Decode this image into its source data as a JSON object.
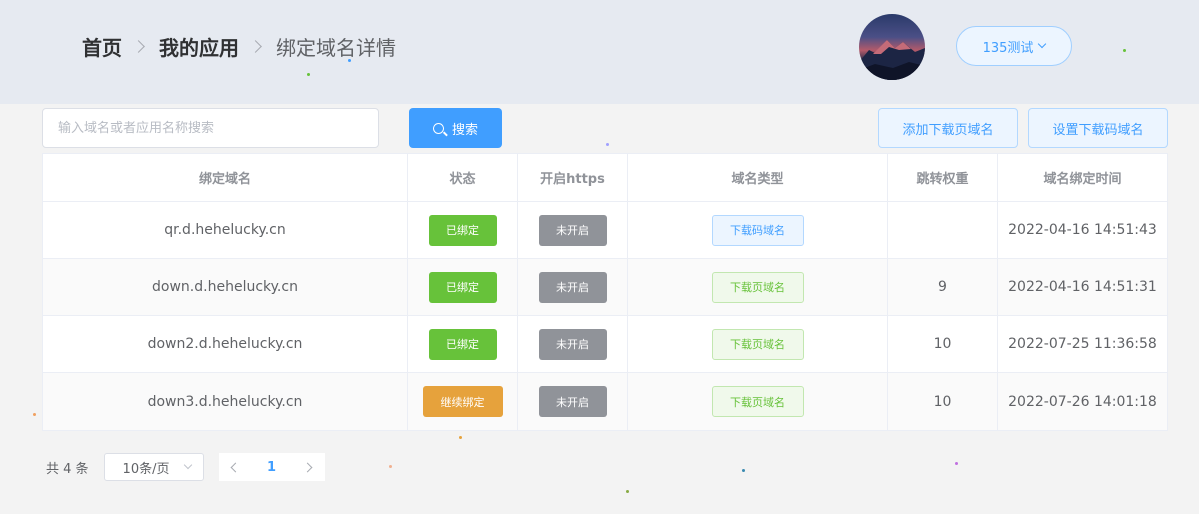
{
  "breadcrumb": {
    "home": "首页",
    "apps": "我的应用",
    "current": "绑定域名详情"
  },
  "user": {
    "name": "135测试",
    "avatar_icon": "avatar-mountain"
  },
  "toolbar": {
    "search_placeholder": "输入域名或者应用名称搜索",
    "search_value": "",
    "search_label": "搜索",
    "add_download_domain_label": "添加下载页域名",
    "set_qrcode_domain_label": "设置下载码域名"
  },
  "table": {
    "columns": [
      "绑定域名",
      "状态",
      "开启https",
      "域名类型",
      "跳转权重",
      "域名绑定时间"
    ],
    "rows": [
      {
        "domain": "qr.d.hehelucky.cn",
        "status": "已绑定",
        "https": "未开启",
        "type": "下载码域名",
        "weight": "",
        "time": "2022-04-16 14:51:43"
      },
      {
        "domain": "down.d.hehelucky.cn",
        "status": "已绑定",
        "https": "未开启",
        "type": "下载页域名",
        "weight": "9",
        "time": "2022-04-16 14:51:31"
      },
      {
        "domain": "down2.d.hehelucky.cn",
        "status": "已绑定",
        "https": "未开启",
        "type": "下载页域名",
        "weight": "10",
        "time": "2022-07-25 11:36:58"
      },
      {
        "domain": "down3.d.hehelucky.cn",
        "status": "继续绑定",
        "https": "未开启",
        "type": "下载页域名",
        "weight": "10",
        "time": "2022-07-26 14:01:18"
      }
    ]
  },
  "pagination": {
    "total": "共 4 条",
    "page_size": "10条/页",
    "current_page": "1"
  },
  "colors": {
    "primary": "#409eff",
    "success": "#67c23a",
    "warning": "#e6a23c",
    "info": "#909399"
  }
}
